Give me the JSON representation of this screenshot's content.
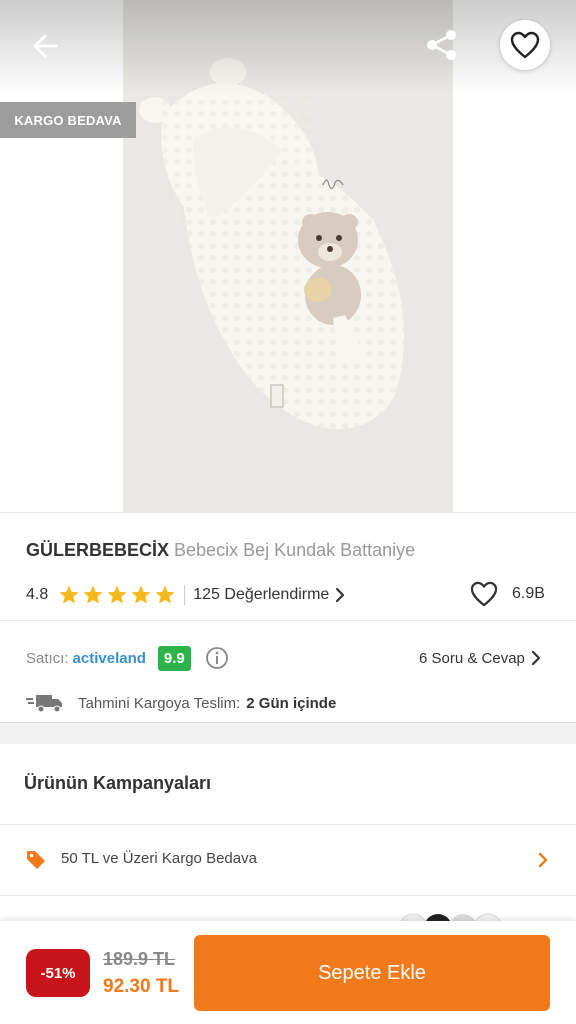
{
  "product_image": {
    "badge": "KARGO BEDAVA",
    "icons": {
      "back": "arrow-left-icon",
      "share": "share-icon",
      "favorite": "heart-outline-icon"
    }
  },
  "product": {
    "brand": "GÜLERBEBECİX",
    "name": "Bebecix Bej Kundak Battaniye",
    "rating": "4.8",
    "stars": 5,
    "reviews_label": "125 Değerlendirme",
    "likes": "6.9B"
  },
  "seller": {
    "label": "Satıcı:",
    "name": "activeland",
    "score": "9.9",
    "qa_label": "6 Soru & Cevap"
  },
  "delivery": {
    "label": "Tahmini Kargoya Teslim:",
    "value": "2 Gün içinde"
  },
  "campaigns": {
    "title": "Ürünün Kampanyaları",
    "items": [
      {
        "label": "50 TL ve Üzeri Kargo Bedava",
        "icon": "tag-icon"
      }
    ]
  },
  "bottom_bar": {
    "discount": "-51%",
    "old_price": "189.9 TL",
    "new_price": "92.30 TL",
    "add_to_cart": "Sepete Ekle"
  },
  "colors": {
    "accent": "#f27a1a",
    "discount": "#c8151b",
    "seller_score": "#2db34a",
    "seller_link": "#3a8fd0",
    "star": "#f6b81e"
  }
}
